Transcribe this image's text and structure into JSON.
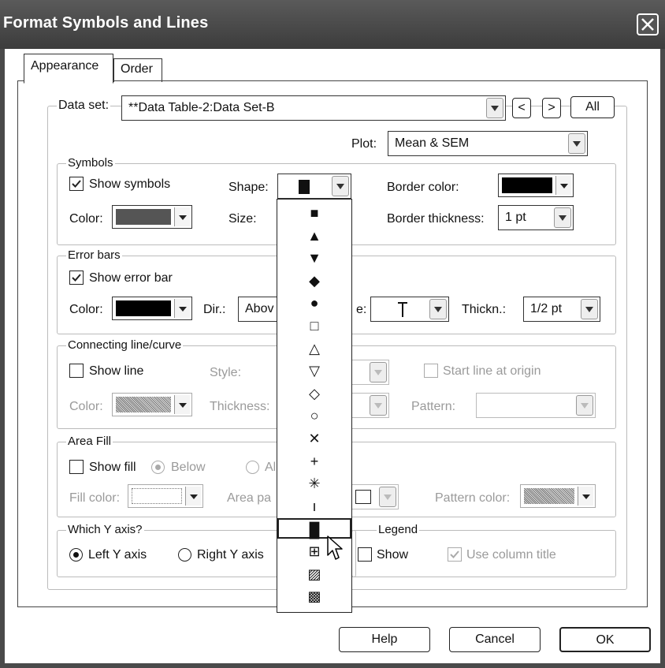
{
  "window": {
    "title": "Format Symbols and Lines"
  },
  "tabs": [
    {
      "label": "Appearance"
    },
    {
      "label": "Order"
    }
  ],
  "dataset": {
    "label": "Data set:",
    "value": "**Data Table-2:Data Set-B",
    "prev": "<",
    "next": ">",
    "all": "All"
  },
  "plot": {
    "label": "Plot:",
    "value": "Mean & SEM"
  },
  "symbols": {
    "group": "Symbols",
    "show_label": "Show symbols",
    "show_checked": true,
    "shape_label": "Shape:",
    "color_label": "Color:",
    "size_label": "Size:",
    "border_color_label": "Border color:",
    "border_thickness_label": "Border thickness:",
    "border_thickness_value": "1 pt",
    "color": "#555555",
    "border_color": "#000000"
  },
  "errorbars": {
    "group": "Error bars",
    "show_label": "Show error bar",
    "show_checked": true,
    "color_label": "Color:",
    "dir_label": "Dir.:",
    "dir_value": "Abov",
    "style_label_partial": "e:",
    "thick_label": "Thickn.:",
    "thick_value": "1/2 pt",
    "color": "#000000"
  },
  "line": {
    "group": "Connecting line/curve",
    "show_label": "Show line",
    "style_label": "Style:",
    "start_label": "Start line at origin",
    "color_label": "Color:",
    "thickness_label": "Thickness:",
    "pattern_label": "Pattern:"
  },
  "area": {
    "group": "Area Fill",
    "show_label": "Show fill",
    "below_label": "Below",
    "above_label_partial": "Al",
    "fill_color_label": "Fill color:",
    "area_pattern_label_partial": "Area pa",
    "pattern_color_label": "Pattern color:"
  },
  "yaxis": {
    "group": "Which Y axis?",
    "left_label": "Left Y axis",
    "right_label": "Right  Y axis",
    "left_selected": true
  },
  "legend": {
    "group": "Legend",
    "show_label": "Show",
    "use_title_label": "Use column title",
    "use_title_checked": true
  },
  "shape_options": [
    "■",
    "▲",
    "▼",
    "◆",
    "●",
    "□",
    "△",
    "▽",
    "◇",
    "○",
    "✕",
    "+",
    "✳",
    "ı",
    "█",
    "⊞",
    "▨",
    "▩"
  ],
  "shape_selected_index": 14,
  "buttons": {
    "help": "Help",
    "cancel": "Cancel",
    "ok": "OK"
  }
}
